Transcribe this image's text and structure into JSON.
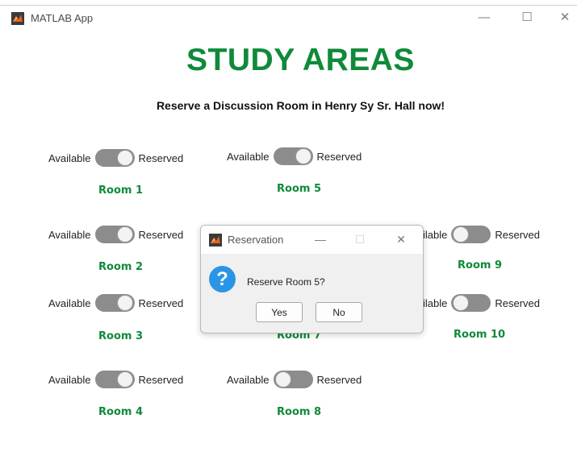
{
  "window": {
    "title": "MATLAB App",
    "minimize_glyph": "—",
    "maximize_glyph": "☐",
    "close_glyph": "✕"
  },
  "header": {
    "title": "STUDY AREAS",
    "subtitle": "Reserve a Discussion Room in Henry Sy Sr. Hall now!"
  },
  "switch_labels": {
    "off": "Available",
    "on": "Reserved"
  },
  "rooms": [
    {
      "label": "Room 1",
      "state": "Reserved"
    },
    {
      "label": "Room 2",
      "state": "Reserved"
    },
    {
      "label": "Room 3",
      "state": "Reserved"
    },
    {
      "label": "Room 4",
      "state": "Reserved"
    },
    {
      "label": "Room 5",
      "state": "Reserved"
    },
    {
      "label": "Room 7",
      "state": "Reserved"
    },
    {
      "label": "Room 8",
      "state": "Available"
    },
    {
      "label": "Room 9",
      "state": "Available"
    },
    {
      "label": "Room 10",
      "state": "Available"
    }
  ],
  "partial_labels": {
    "room9_left": "ilable",
    "room10_left": "ilable",
    "room7_text": "Room 7"
  },
  "dialog": {
    "title": "Reservation",
    "message": "Reserve Room 5?",
    "yes": "Yes",
    "no": "No",
    "icon": "question-icon",
    "minimize_glyph": "—",
    "maximize_glyph": "☐",
    "close_glyph": "✕"
  },
  "colors": {
    "accent_green": "#0f8a3a",
    "switch_track": "#8c8c8c",
    "question_blue": "#2a95e6"
  }
}
